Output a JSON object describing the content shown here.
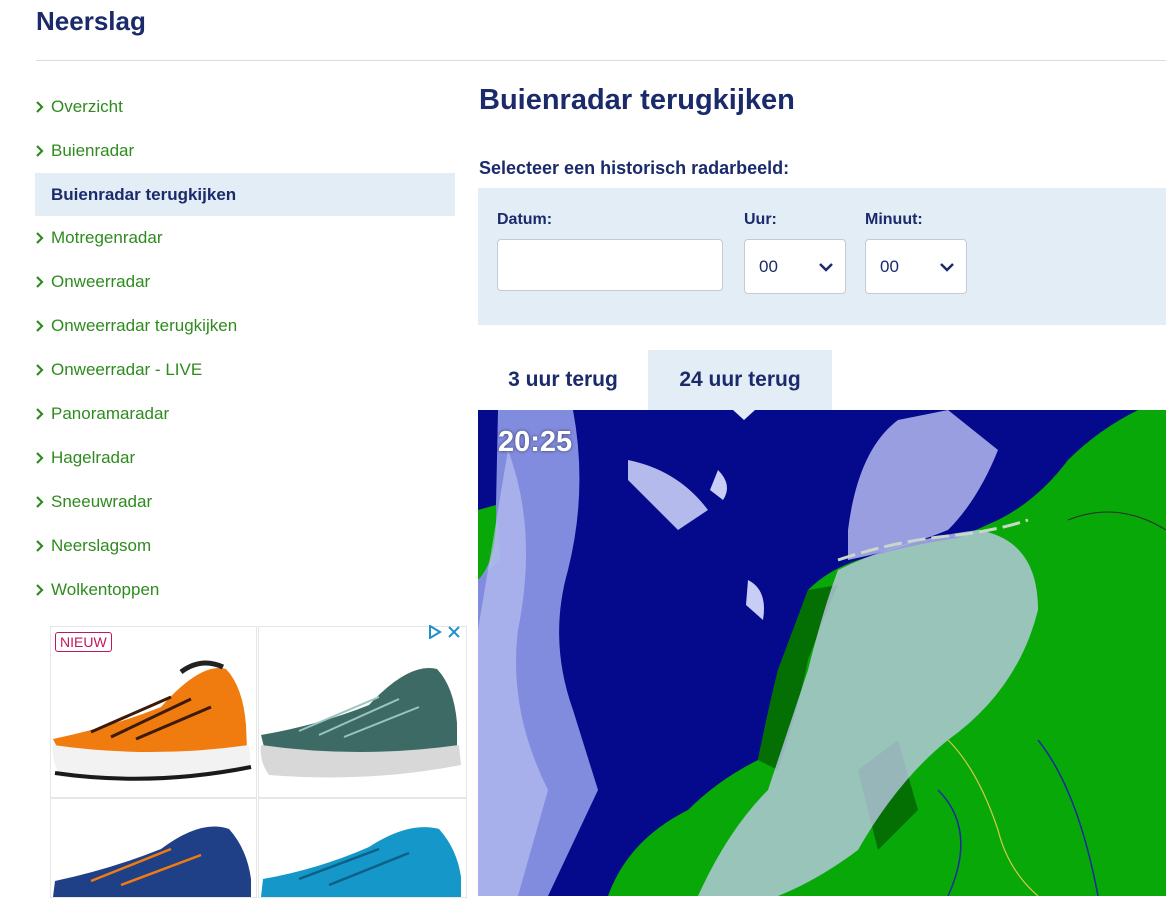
{
  "page": {
    "title": "Neerslag"
  },
  "sidebar": {
    "items": [
      {
        "label": "Overzicht",
        "active": false
      },
      {
        "label": "Buienradar",
        "active": false
      },
      {
        "label": "Buienradar terugkijken",
        "active": true
      },
      {
        "label": "Motregenradar",
        "active": false
      },
      {
        "label": "Onweerradar",
        "active": false
      },
      {
        "label": "Onweerradar terugkijken",
        "active": false
      },
      {
        "label": "Onweerradar - LIVE",
        "active": false
      },
      {
        "label": "Panoramaradar",
        "active": false
      },
      {
        "label": "Hagelradar",
        "active": false
      },
      {
        "label": "Sneeuwradar",
        "active": false
      },
      {
        "label": "Neerslagsom",
        "active": false
      },
      {
        "label": "Wolkentoppen",
        "active": false
      }
    ]
  },
  "ad": {
    "badge": "NIEUW",
    "icons": [
      "adchoices-icon",
      "close-icon"
    ]
  },
  "main": {
    "heading": "Buienradar terugkijken",
    "select_label": "Selecteer een historisch radarbeeld:",
    "form": {
      "date_label": "Datum:",
      "date_value": "",
      "hour_label": "Uur:",
      "hour_value": "00",
      "minute_label": "Minuut:",
      "minute_value": "00"
    },
    "tabs": [
      {
        "label": "3 uur terug",
        "active": false
      },
      {
        "label": "24 uur terug",
        "active": true
      }
    ],
    "map": {
      "time": "20:25"
    }
  },
  "colors": {
    "navy": "#1b2a6b",
    "link_green": "#2e8b1e",
    "panel_bg": "#e3edf6",
    "sea": "#050a8c",
    "land": "#08a808",
    "rain_light": "#c8cdf5"
  }
}
